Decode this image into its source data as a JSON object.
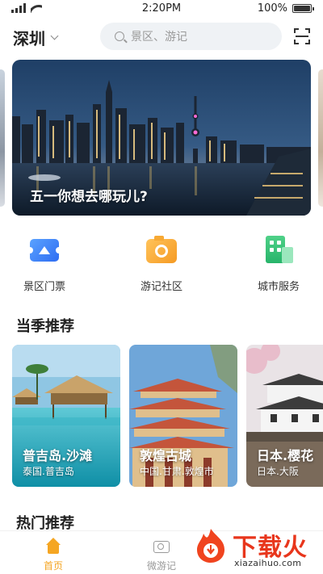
{
  "status_bar": {
    "time": "2:20PM",
    "battery": "100%",
    "battery_level": 1.0
  },
  "header": {
    "city": "深圳",
    "search_placeholder": "景区、游记"
  },
  "banner": {
    "caption": "五一你想去哪玩儿?"
  },
  "services": [
    {
      "label": "景区门票",
      "icon": "ticket-icon"
    },
    {
      "label": "游记社区",
      "icon": "camera-icon"
    },
    {
      "label": "城市服务",
      "icon": "building-icon"
    }
  ],
  "season": {
    "title": "当季推荐",
    "cards": [
      {
        "title": "普吉岛.沙滩",
        "subtitle": "泰国.普吉岛"
      },
      {
        "title": "敦煌古城",
        "subtitle": "中国.甘肃.敦煌市"
      },
      {
        "title": "日本.樱花",
        "subtitle": "日本.大阪"
      }
    ]
  },
  "hot": {
    "title": "热门推荐"
  },
  "tabbar": {
    "tabs": [
      {
        "label": "首页",
        "icon": "home-icon",
        "active": true
      },
      {
        "label": "微游记",
        "icon": "camera-icon",
        "active": false
      }
    ],
    "active_color": "#f5a623",
    "inactive_color": "#999999"
  },
  "watermark": {
    "name": "下载火",
    "url": "xiazaihuo.com"
  }
}
